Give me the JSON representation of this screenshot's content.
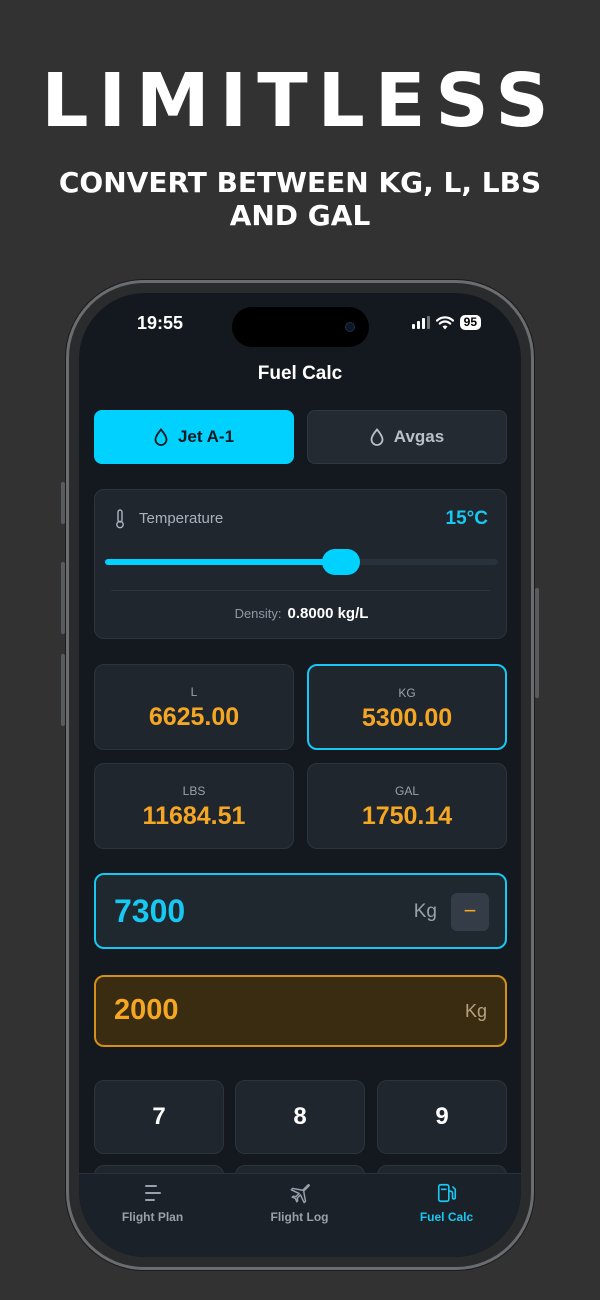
{
  "promo": {
    "title": "LIMITLESS",
    "subtitle": "CONVERT BETWEEN KG, L, LBS AND GAL"
  },
  "status_bar": {
    "time": "19:55",
    "battery": "95"
  },
  "screen": {
    "title": "Fuel Calc"
  },
  "fuel_types": [
    {
      "label": "Jet A-1",
      "active": true
    },
    {
      "label": "Avgas",
      "active": false
    }
  ],
  "temperature": {
    "label": "Temperature",
    "value": "15°C",
    "slider_fraction": 0.6,
    "density_label": "Density:",
    "density_value": "0.8000 kg/L"
  },
  "units": [
    {
      "label": "L",
      "value": "6625.00",
      "selected": false
    },
    {
      "label": "KG",
      "value": "5300.00",
      "selected": true
    },
    {
      "label": "LBS",
      "value": "11684.51",
      "selected": false
    },
    {
      "label": "GAL",
      "value": "1750.14",
      "selected": false
    }
  ],
  "input_main": {
    "value": "7300",
    "unit": "Kg",
    "minus_label": "−"
  },
  "input_secondary": {
    "value": "2000",
    "unit": "Kg"
  },
  "keypad": {
    "row1": [
      "7",
      "8",
      "9"
    ]
  },
  "tabbar": [
    {
      "label": "Flight Plan",
      "icon": "list-icon",
      "active": false
    },
    {
      "label": "Flight Log",
      "icon": "airplane-icon",
      "active": false
    },
    {
      "label": "Fuel Calc",
      "icon": "fuel-pump-icon",
      "active": true
    }
  ],
  "colors": {
    "accent_cyan": "#00d1ff",
    "accent_orange": "#f5a623",
    "background": "#323233",
    "screen_bg": "#14191f"
  }
}
